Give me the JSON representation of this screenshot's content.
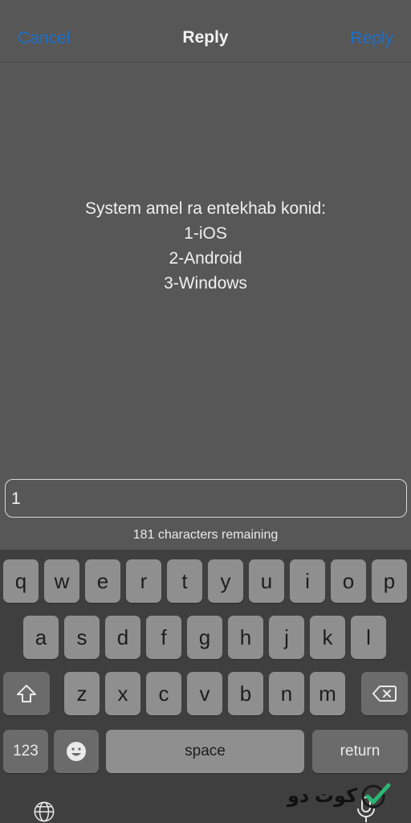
{
  "nav": {
    "cancel_label": "Cancel",
    "title": "Reply",
    "reply_label": "Reply"
  },
  "message": {
    "lines": [
      "System amel ra entekhab konid:",
      "1-iOS",
      "2-Android",
      "3-Windows"
    ]
  },
  "reply_field": {
    "value": "1"
  },
  "remaining_text": "181 characters remaining",
  "keyboard": {
    "row1": [
      "q",
      "w",
      "e",
      "r",
      "t",
      "y",
      "u",
      "i",
      "o",
      "p"
    ],
    "row2": [
      "a",
      "s",
      "d",
      "f",
      "g",
      "h",
      "j",
      "k",
      "l"
    ],
    "row3": [
      "z",
      "x",
      "c",
      "v",
      "b",
      "n",
      "m"
    ],
    "numbers_label": "123",
    "space_label": "space",
    "return_label": "return"
  },
  "colors": {
    "accent": "#1e6fc8",
    "background": "#575757",
    "keyboard_bg": "#3f3f3f",
    "key": "#8f8f8f",
    "key_dark": "#6b6b6b",
    "watermark_check": "#2bb673"
  },
  "icons": {
    "shift": "shift-icon",
    "delete": "backspace-icon",
    "emoji": "emoji-icon",
    "globe": "globe-icon",
    "mic": "microphone-icon",
    "watermark_check": "checkmark-icon"
  },
  "watermark_text": "کوت دو"
}
